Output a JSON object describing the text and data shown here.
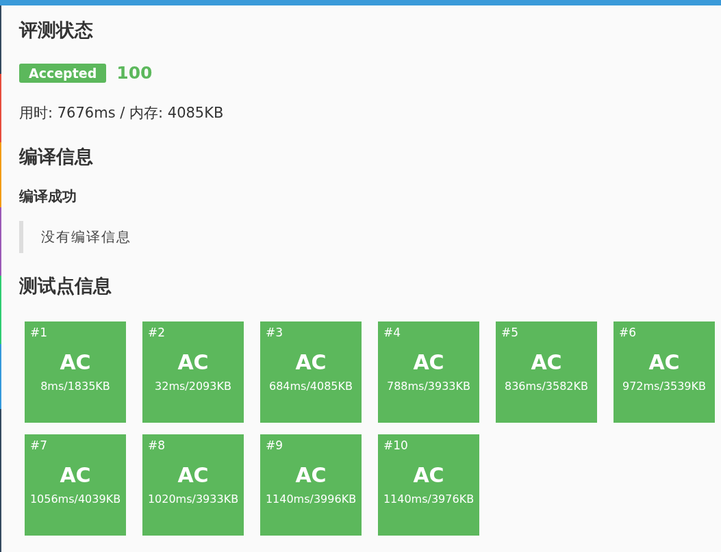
{
  "status": {
    "title": "评测状态",
    "verdict": "Accepted",
    "score": "100",
    "usage": "用时: 7676ms / 内存: 4085KB"
  },
  "compile": {
    "title": "编译信息",
    "subtitle": "编译成功",
    "message": "没有编译信息"
  },
  "testcases": {
    "title": "测试点信息",
    "cases": [
      {
        "id": "#1",
        "result": "AC",
        "usage": "8ms/1835KB",
        "color": "#5cb85c"
      },
      {
        "id": "#2",
        "result": "AC",
        "usage": "32ms/2093KB",
        "color": "#5cb85c"
      },
      {
        "id": "#3",
        "result": "AC",
        "usage": "684ms/4085KB",
        "color": "#5cb85c"
      },
      {
        "id": "#4",
        "result": "AC",
        "usage": "788ms/3933KB",
        "color": "#5cb85c"
      },
      {
        "id": "#5",
        "result": "AC",
        "usage": "836ms/3582KB",
        "color": "#5cb85c"
      },
      {
        "id": "#6",
        "result": "AC",
        "usage": "972ms/3539KB",
        "color": "#5cb85c"
      },
      {
        "id": "#7",
        "result": "AC",
        "usage": "1056ms/4039KB",
        "color": "#5cb85c"
      },
      {
        "id": "#8",
        "result": "AC",
        "usage": "1020ms/3933KB",
        "color": "#5cb85c"
      },
      {
        "id": "#9",
        "result": "AC",
        "usage": "1140ms/3996KB",
        "color": "#5cb85c"
      },
      {
        "id": "#10",
        "result": "AC",
        "usage": "1140ms/3976KB",
        "color": "#5cb85c"
      }
    ]
  }
}
